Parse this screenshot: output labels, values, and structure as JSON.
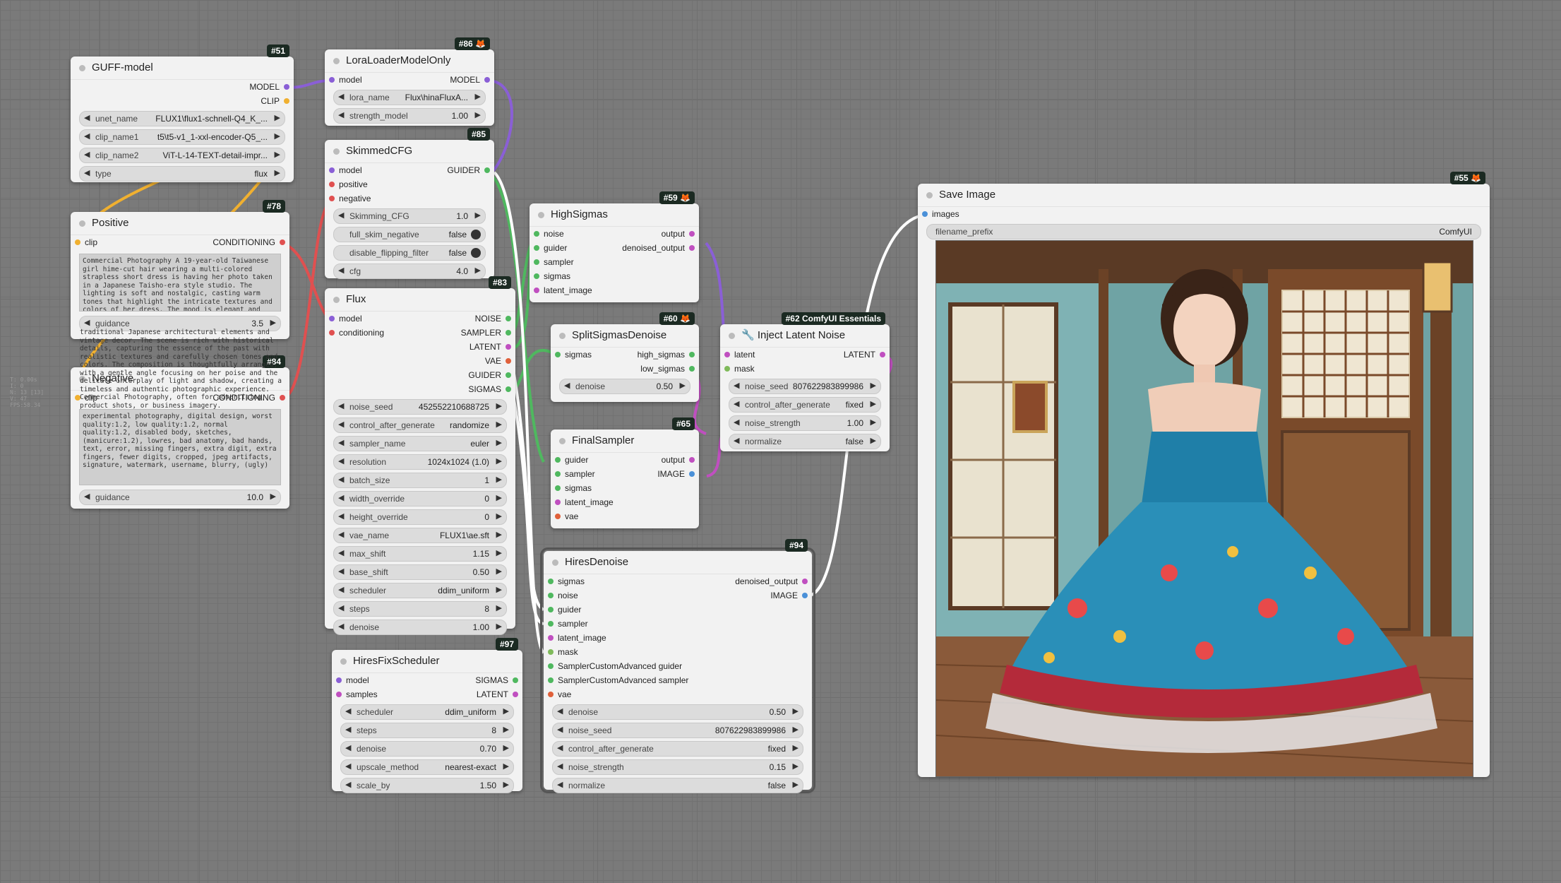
{
  "nodes": {
    "guff": {
      "badge": "#51",
      "title": "GUFF-model",
      "outputs": [
        "MODEL",
        "CLIP"
      ],
      "widgets": [
        {
          "label": "unet_name",
          "value": "FLUX1\\flux1-schnell-Q4_K_..."
        },
        {
          "label": "clip_name1",
          "value": "t5\\t5-v1_1-xxl-encoder-Q5_..."
        },
        {
          "label": "clip_name2",
          "value": "ViT-L-14-TEXT-detail-impr..."
        },
        {
          "label": "type",
          "value": "flux"
        }
      ]
    },
    "lora": {
      "badge": "#86 🦊",
      "title": "LoraLoaderModelOnly",
      "inputs": [
        "model"
      ],
      "outputs": [
        "MODEL"
      ],
      "widgets": [
        {
          "label": "lora_name",
          "value": "Flux\\hinaFluxA..."
        },
        {
          "label": "strength_model",
          "value": "1.00"
        }
      ]
    },
    "skimmed": {
      "badge": "#85",
      "title": "SkimmedCFG",
      "inputs": [
        "model",
        "positive",
        "negative"
      ],
      "outputs": [
        "GUIDER"
      ],
      "widgets": [
        {
          "label": "Skimming_CFG",
          "value": "1.0"
        },
        {
          "label": "full_skim_negative",
          "value": "false"
        },
        {
          "label": "disable_flipping_filter",
          "value": "false"
        },
        {
          "label": "cfg",
          "value": "4.0"
        }
      ]
    },
    "positive": {
      "badge": "#78",
      "title": "Positive",
      "inputs": [
        "clip"
      ],
      "outputs": [
        "CONDITIONING"
      ],
      "text": "Commercial Photography A 19-year-old Taiwanese girl hime-cut hair wearing a multi-colored strapless short dress is having her photo taken in a Japanese Taisho-era style studio. The lighting is soft and nostalgic, casting warm tones that highlight the intricate textures and colors of her dress. The mood is elegant and slightly melancholic, as she",
      "widgets": [
        {
          "label": "guidance",
          "value": "3.5"
        }
      ]
    },
    "negative": {
      "badge": "#84",
      "title": "Negative",
      "inputs": [
        "clip"
      ],
      "outputs": [
        "CONDITIONING"
      ],
      "overflow_text": "traditional Japanese architectural elements and vintage decor. The scene is rich with historical details, capturing the essence of the past with realistic textures and carefully chosen tones and colors. The composition is thoughtfully arranged, with a gentle angle focusing on her poise and the delicate interplay of light and shadow, creating a timeless and authentic photographic experience. Commercial Photography, often for advertising, product shots, or business imagery.",
      "text": "experimental photography, digital design, worst quality:1.2, low quality:1.2, normal quality:1.2, disabled body, sketches, (manicure:1.2), lowres, bad anatomy, bad hands, text, error, missing fingers, extra digit, extra fingers, fewer digits, cropped, jpeg artifacts, signature, watermark, username, blurry, (ugly)",
      "widgets": [
        {
          "label": "guidance",
          "value": "10.0"
        }
      ]
    },
    "flux": {
      "badge": "#83",
      "title": "Flux",
      "inputs": [
        "model",
        "conditioning"
      ],
      "outputs": [
        "NOISE",
        "SAMPLER",
        "LATENT",
        "VAE",
        "GUIDER",
        "SIGMAS"
      ],
      "widgets": [
        {
          "label": "noise_seed",
          "value": "452552210688725"
        },
        {
          "label": "control_after_generate",
          "value": "randomize"
        },
        {
          "label": "sampler_name",
          "value": "euler"
        },
        {
          "label": "resolution",
          "value": "1024x1024 (1.0)"
        },
        {
          "label": "batch_size",
          "value": "1"
        },
        {
          "label": "width_override",
          "value": "0"
        },
        {
          "label": "height_override",
          "value": "0"
        },
        {
          "label": "vae_name",
          "value": "FLUX1\\ae.sft"
        },
        {
          "label": "max_shift",
          "value": "1.15"
        },
        {
          "label": "base_shift",
          "value": "0.50"
        },
        {
          "label": "scheduler",
          "value": "ddim_uniform"
        },
        {
          "label": "steps",
          "value": "8"
        },
        {
          "label": "denoise",
          "value": "1.00"
        }
      ]
    },
    "highsigmas": {
      "badge": "#59 🦊",
      "title": "HighSigmas",
      "inputs": [
        "noise",
        "guider",
        "sampler",
        "sigmas",
        "latent_image"
      ],
      "outputs": [
        "output",
        "denoised_output"
      ]
    },
    "split": {
      "badge": "#60 🦊",
      "title": "SplitSigmasDenoise",
      "inputs": [
        "sigmas"
      ],
      "outputs": [
        "high_sigmas",
        "low_sigmas"
      ],
      "widgets": [
        {
          "label": "denoise",
          "value": "0.50"
        }
      ]
    },
    "final": {
      "badge": "#65",
      "title": "FinalSampler",
      "inputs": [
        "guider",
        "sampler",
        "sigmas",
        "latent_image",
        "vae"
      ],
      "outputs": [
        "output",
        "IMAGE"
      ]
    },
    "inject": {
      "badge": "#62 ComfyUI Essentials",
      "title": "🔧 Inject Latent Noise",
      "inputs": [
        "latent",
        "mask"
      ],
      "outputs": [
        "LATENT"
      ],
      "widgets": [
        {
          "label": "noise_seed",
          "value": "807622983899986"
        },
        {
          "label": "control_after_generate",
          "value": "fixed"
        },
        {
          "label": "noise_strength",
          "value": "1.00"
        },
        {
          "label": "normalize",
          "value": "false"
        }
      ]
    },
    "hiresfix": {
      "badge": "#97",
      "title": "HiresFixScheduler",
      "inputs": [
        "model",
        "samples"
      ],
      "outputs": [
        "SIGMAS",
        "LATENT"
      ],
      "widgets": [
        {
          "label": "scheduler",
          "value": "ddim_uniform"
        },
        {
          "label": "steps",
          "value": "8"
        },
        {
          "label": "denoise",
          "value": "0.70"
        },
        {
          "label": "upscale_method",
          "value": "nearest-exact"
        },
        {
          "label": "scale_by",
          "value": "1.50"
        }
      ]
    },
    "hires": {
      "badge": "#94",
      "title": "HiresDenoise",
      "inputs": [
        "sigmas",
        "noise",
        "guider",
        "sampler",
        "latent_image",
        "mask",
        "SamplerCustomAdvanced guider",
        "SamplerCustomAdvanced sampler",
        "vae"
      ],
      "outputs": [
        "denoised_output",
        "IMAGE"
      ],
      "widgets": [
        {
          "label": "denoise",
          "value": "0.50"
        },
        {
          "label": "noise_seed",
          "value": "807622983899986"
        },
        {
          "label": "control_after_generate",
          "value": "fixed"
        },
        {
          "label": "noise_strength",
          "value": "0.15"
        },
        {
          "label": "normalize",
          "value": "false"
        }
      ]
    },
    "save": {
      "badge": "#55 🦊",
      "title": "Save Image",
      "inputs": [
        "images"
      ],
      "widgets": [
        {
          "label": "filename_prefix",
          "value": "ComfyUI"
        }
      ]
    }
  },
  "hud": [
    "T: 0.00s",
    "I: 0",
    "N: 13 [13]",
    "V: 47",
    "FPS:58.34"
  ],
  "colors": {
    "model": "#8a5fd6",
    "clip": "#f0b030",
    "conditioning": "#e05050",
    "guider": "#4fb85f",
    "latent": "#c04fc0",
    "image": "#4a90d8",
    "vae": "#e0603a"
  }
}
